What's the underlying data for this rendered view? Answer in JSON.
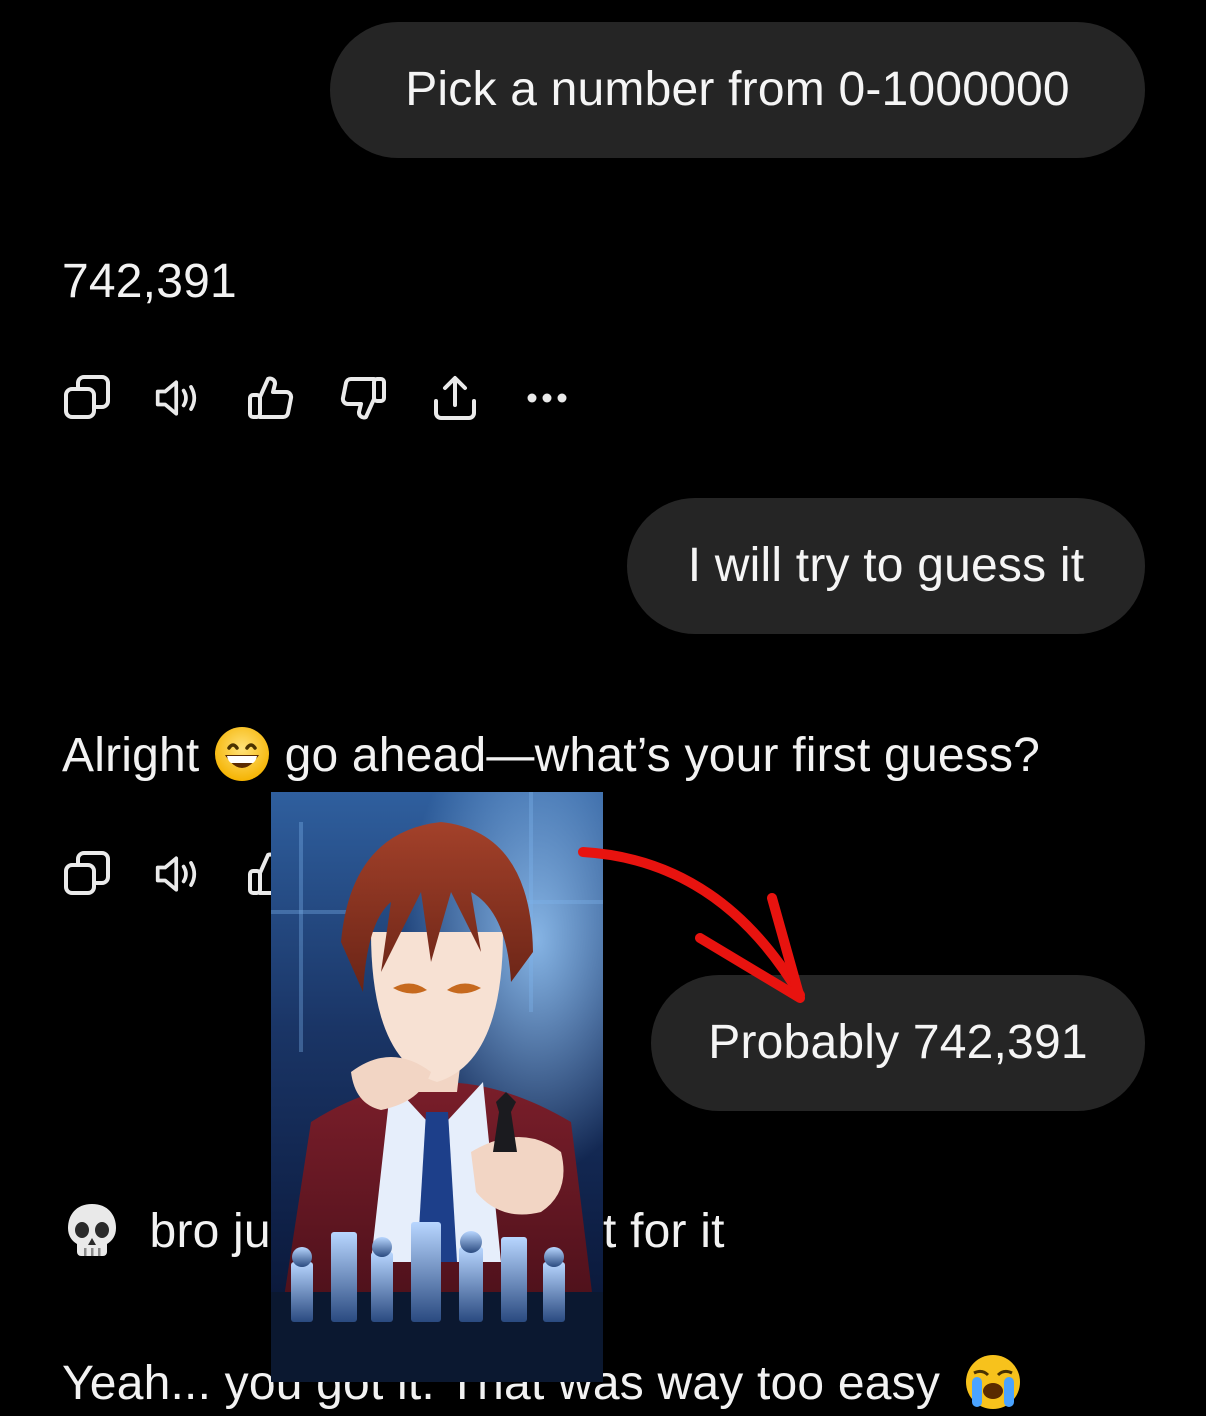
{
  "messages": [
    {
      "role": "user",
      "text": "Pick a number from 0-1000000"
    },
    {
      "role": "assistant",
      "text": "742,391"
    },
    {
      "role": "user",
      "text": "I will try to guess it"
    },
    {
      "role": "assistant",
      "text_before": "Alright",
      "emoji": "grinning-face",
      "text_after": "go ahead—what’s your first guess?"
    },
    {
      "role": "user",
      "text": "Probably 742,391"
    },
    {
      "role": "assistant",
      "emoji": "skull",
      "text_visible_left": "bro ju",
      "text_visible_right": "t for it"
    },
    {
      "role": "assistant",
      "text": "Yeah... you got it. That was way too easy",
      "emoji": "loudly-crying-face"
    }
  ],
  "actions": [
    {
      "icon": "copy-icon"
    },
    {
      "icon": "read-aloud-icon"
    },
    {
      "icon": "thumbs-up-icon"
    },
    {
      "icon": "thumbs-down-icon"
    },
    {
      "icon": "share-icon"
    },
    {
      "icon": "more-icon"
    }
  ],
  "overlay": {
    "image": "anime-character-with-chess-pieces",
    "arrow_color": "#e8130f"
  },
  "colors": {
    "background": "#000000",
    "bubble": "#252525",
    "text": "#f4f4f4"
  }
}
